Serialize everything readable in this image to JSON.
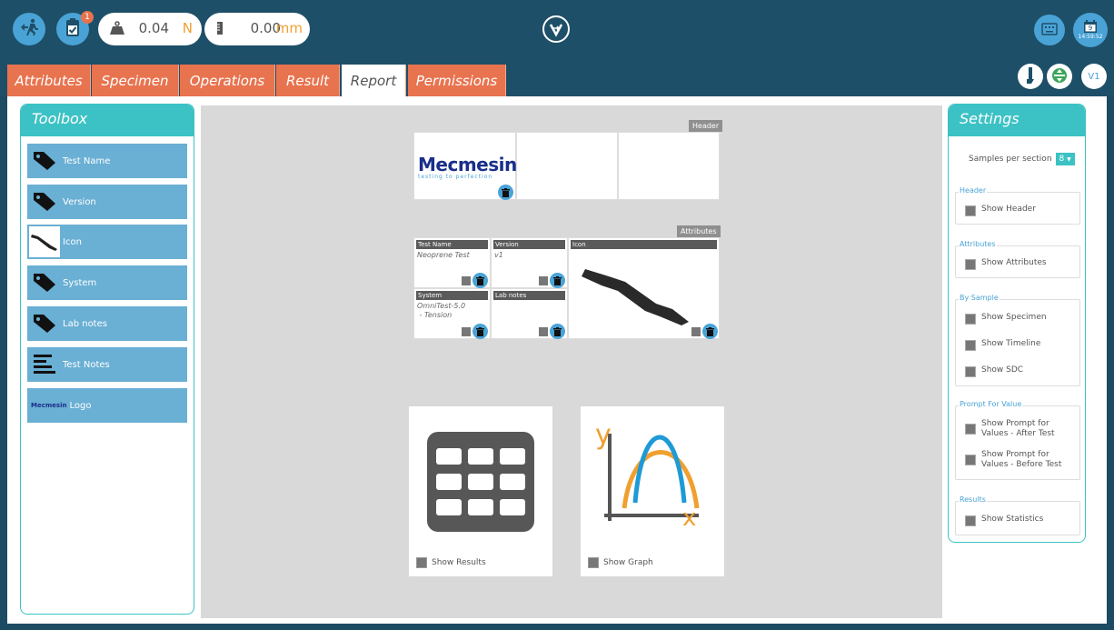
{
  "topbar": {
    "notification_count": "1",
    "load_value": "0.04",
    "load_unit": "N",
    "position_value": "0.00",
    "position_unit": "mm",
    "calendar_day": "9",
    "clock_time": "14:59:52"
  },
  "tabs": [
    {
      "label": "Attributes",
      "active": false
    },
    {
      "label": "Specimen",
      "active": false
    },
    {
      "label": "Operations",
      "active": false
    },
    {
      "label": "Result",
      "active": false
    },
    {
      "label": "Report",
      "active": true
    },
    {
      "label": "Permissions",
      "active": false
    }
  ],
  "version_badge": "V1",
  "toolbox": {
    "title": "Toolbox",
    "items": [
      {
        "label": "Test Name",
        "icon": "tag-icon"
      },
      {
        "label": "Version",
        "icon": "tag-icon"
      },
      {
        "label": "Icon",
        "icon": "specimen-image-icon"
      },
      {
        "label": "System",
        "icon": "tag-icon"
      },
      {
        "label": "Lab notes",
        "icon": "tag-icon"
      },
      {
        "label": "Test Notes",
        "icon": "text-lines-icon"
      },
      {
        "label": "Logo",
        "icon": "mecmesin-logo-icon",
        "logo_text": "Mecmesin"
      }
    ]
  },
  "canvas": {
    "header_section": {
      "tag": "Header",
      "logo_text": "Mecmesin",
      "logo_tagline": "testing to perfection"
    },
    "attributes_section": {
      "tag": "Attributes",
      "cells": [
        {
          "label": "Test Name",
          "value": "Neoprene Test"
        },
        {
          "label": "Version",
          "value": "v1"
        },
        {
          "label": "Icon",
          "value": ""
        },
        {
          "label": "System",
          "value": "OmniTest-5.0",
          "value2": " - Tension"
        },
        {
          "label": "Lab notes",
          "value": ""
        }
      ]
    },
    "results_card": {
      "label": "Show Results"
    },
    "graph_card": {
      "label": "Show Graph",
      "axis_y": "y",
      "axis_x": "x"
    }
  },
  "settings": {
    "title": "Settings",
    "samples_label": "Samples per section",
    "samples_value": "8",
    "groups": [
      {
        "legend": "Header",
        "items": [
          "Show Header"
        ]
      },
      {
        "legend": "Attributes",
        "items": [
          "Show Attributes"
        ]
      },
      {
        "legend": "By Sample",
        "items": [
          "Show Specimen",
          "Show Timeline",
          "Show SDC"
        ]
      },
      {
        "legend": "Prompt For Value",
        "items": [
          "Show Prompt for Values - After Test",
          "Show Prompt for Values - Before Test"
        ]
      },
      {
        "legend": "Results",
        "items": [
          "Show Statistics"
        ]
      }
    ]
  },
  "colors": {
    "topbar": "#1e4f68",
    "accent_blue": "#4aa3d6",
    "tab_orange": "#e8734f",
    "teal": "#3cc2c4",
    "unit_orange": "#f0a030"
  }
}
